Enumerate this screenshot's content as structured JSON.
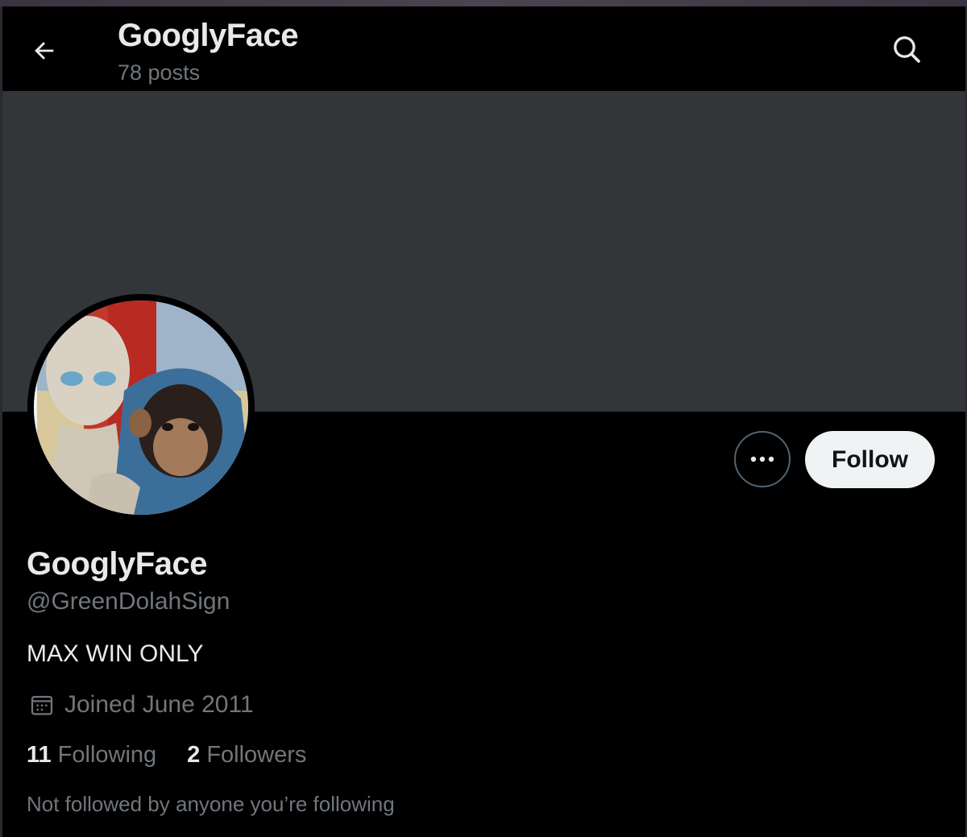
{
  "header": {
    "back_icon": "arrow-left-icon",
    "title": "GooglyFace",
    "posts_count": "78 posts",
    "search_icon": "search-icon"
  },
  "profile": {
    "avatar_description": "painting of alien and chimpanzee",
    "name": "GooglyFace",
    "handle": "@GreenDolahSign",
    "bio": "MAX WIN ONLY",
    "joined": "Joined June 2011",
    "following_count": "11",
    "following_label": "Following",
    "followers_count": "2",
    "followers_label": "Followers",
    "not_followed_text": "Not followed by anyone you’re following"
  },
  "actions": {
    "more_icon": "more-horizontal-icon",
    "follow_label": "Follow"
  },
  "colors": {
    "background": "#000000",
    "banner": "#333639",
    "primary_text": "#e7e9ea",
    "secondary_text": "#71767b",
    "follow_button_bg": "#eff3f4"
  }
}
